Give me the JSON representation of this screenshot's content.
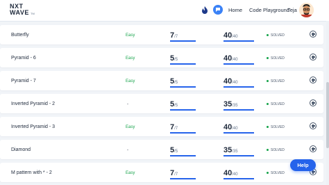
{
  "header": {
    "logo_line1": "NXT",
    "logo_line2": "WAVE",
    "logo_tm": "TM",
    "nav": {
      "home": "Home",
      "playground": "Code Playground",
      "user": "Teja"
    }
  },
  "rows": [
    {
      "name": "Butterfly",
      "difficulty": "Easy",
      "score_a": "7",
      "score_a_total": "/7",
      "score_b": "40",
      "score_b_total": "/40",
      "status": "SOLVED"
    },
    {
      "name": "Pyramid - 6",
      "difficulty": "Easy",
      "score_a": "5",
      "score_a_total": "/5",
      "score_b": "40",
      "score_b_total": "/40",
      "status": "SOLVED"
    },
    {
      "name": "Pyramid - 7",
      "difficulty": "Easy",
      "score_a": "5",
      "score_a_total": "/5",
      "score_b": "40",
      "score_b_total": "/40",
      "status": "SOLVED"
    },
    {
      "name": "Inverted Pyramid - 2",
      "difficulty": "-",
      "score_a": "5",
      "score_a_total": "/5",
      "score_b": "35",
      "score_b_total": "/35",
      "status": "SOLVED"
    },
    {
      "name": "Inverted Pyramid - 3",
      "difficulty": "Easy",
      "score_a": "7",
      "score_a_total": "/7",
      "score_b": "40",
      "score_b_total": "/40",
      "status": "SOLVED"
    },
    {
      "name": "Diamond",
      "difficulty": "-",
      "score_a": "5",
      "score_a_total": "/5",
      "score_b": "35",
      "score_b_total": "/35",
      "status": "SOLVED"
    },
    {
      "name": "M pattern with * - 2",
      "difficulty": "Easy",
      "score_a": "7",
      "score_a_total": "/7",
      "score_b": "40",
      "score_b_total": "/40",
      "status": "SOLVED"
    }
  ],
  "help_label": "Help",
  "colors": {
    "accent": "#2563eb",
    "easy": "#16a34a",
    "solved_dot": "#16a34a"
  }
}
